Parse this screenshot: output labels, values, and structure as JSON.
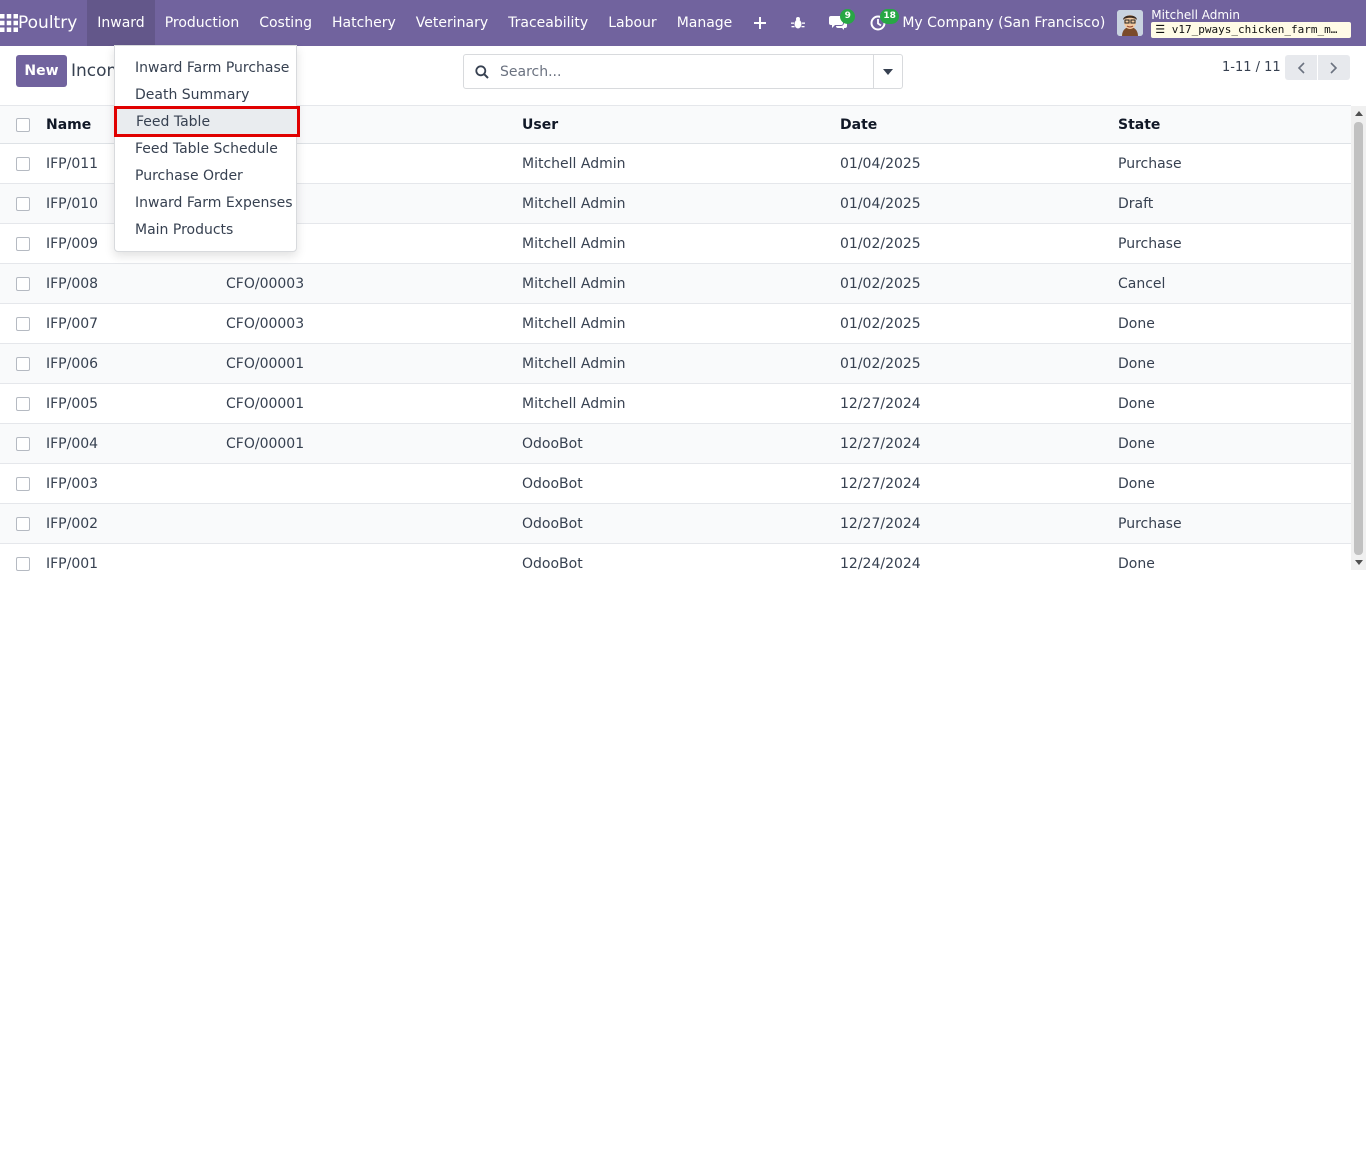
{
  "navbar": {
    "brand": "Poultry",
    "menu": [
      "Inward",
      "Production",
      "Costing",
      "Hatchery",
      "Veterinary",
      "Traceability",
      "Labour",
      "Manage"
    ],
    "active_menu": "Inward",
    "messages_count": "9",
    "activities_count": "18",
    "company": "My Company (San Francisco)",
    "user_name": "Mitchell Admin",
    "database": "v17_pways_chicken_farm_m…",
    "accent_color": "#71639e"
  },
  "control_panel": {
    "new_label": "New",
    "title": "Incom",
    "search_placeholder": "Search...",
    "pager_value": "1-11 / 11"
  },
  "dropdown": {
    "items": [
      "Inward Farm Purchase",
      "Death Summary",
      "Feed Table",
      "Feed Table Schedule",
      "Purchase Order",
      "Inward Farm Expenses",
      "Main Products"
    ],
    "highlighted": "Feed Table"
  },
  "table": {
    "columns": [
      "Name",
      "",
      "User",
      "Date",
      "State"
    ],
    "rows": [
      {
        "name": "IFP/011",
        "ref": "",
        "user": "Mitchell Admin",
        "date": "01/04/2025",
        "state": "Purchase"
      },
      {
        "name": "IFP/010",
        "ref": "",
        "user": "Mitchell Admin",
        "date": "01/04/2025",
        "state": "Draft"
      },
      {
        "name": "IFP/009",
        "ref": "",
        "user": "Mitchell Admin",
        "date": "01/02/2025",
        "state": "Purchase"
      },
      {
        "name": "IFP/008",
        "ref": "CFO/00003",
        "user": "Mitchell Admin",
        "date": "01/02/2025",
        "state": "Cancel"
      },
      {
        "name": "IFP/007",
        "ref": "CFO/00003",
        "user": "Mitchell Admin",
        "date": "01/02/2025",
        "state": "Done"
      },
      {
        "name": "IFP/006",
        "ref": "CFO/00001",
        "user": "Mitchell Admin",
        "date": "01/02/2025",
        "state": "Done"
      },
      {
        "name": "IFP/005",
        "ref": "CFO/00001",
        "user": "Mitchell Admin",
        "date": "12/27/2024",
        "state": "Done"
      },
      {
        "name": "IFP/004",
        "ref": "CFO/00001",
        "user": "OdooBot",
        "date": "12/27/2024",
        "state": "Done"
      },
      {
        "name": "IFP/003",
        "ref": "",
        "user": "OdooBot",
        "date": "12/27/2024",
        "state": "Done"
      },
      {
        "name": "IFP/002",
        "ref": "",
        "user": "OdooBot",
        "date": "12/27/2024",
        "state": "Purchase"
      },
      {
        "name": "IFP/001",
        "ref": "",
        "user": "OdooBot",
        "date": "12/24/2024",
        "state": "Done"
      }
    ]
  }
}
